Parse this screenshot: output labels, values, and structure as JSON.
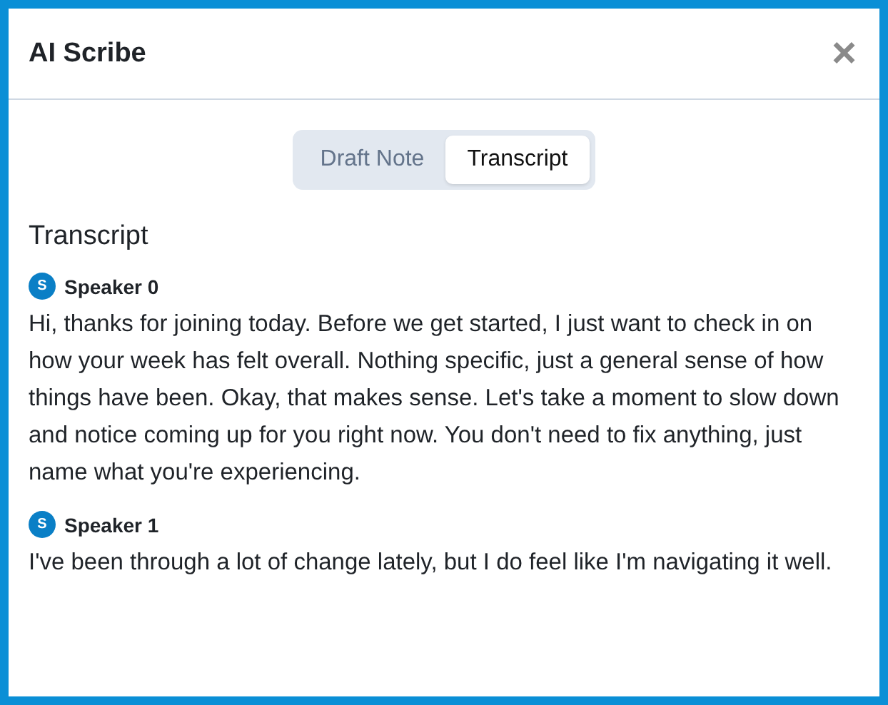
{
  "dialog": {
    "title": "AI Scribe",
    "close": "×"
  },
  "tabs": [
    {
      "label": "Draft Note",
      "selected": false
    },
    {
      "label": "Transcript",
      "selected": true
    }
  ],
  "section_title": "Transcript",
  "entries": [
    {
      "avatar": "S",
      "speaker": "Speaker 0",
      "text": "Hi, thanks for joining today. Before we get started, I just want to check in on how your week has felt overall. Nothing specific, just a general sense of how things have been. Okay, that makes sense. Let's take a moment to slow down and notice coming up for you right now. You don't need to fix anything, just name what you're experiencing."
    },
    {
      "avatar": "S",
      "speaker": "Speaker 1",
      "text": "I've been through a lot of change lately, but I do feel like I'm navigating it well."
    }
  ]
}
